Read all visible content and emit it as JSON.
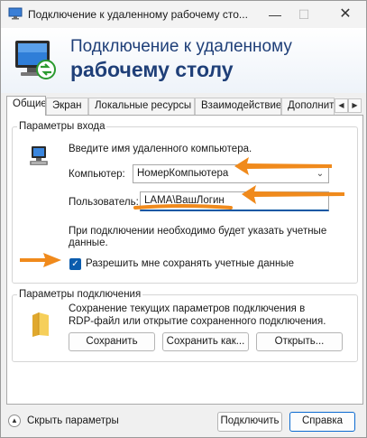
{
  "window": {
    "title": "Подключение к удаленному рабочему сто...",
    "minimize": "—",
    "maximize": "☐",
    "close": "✕"
  },
  "banner": {
    "line1": "Подключение к удаленному",
    "line2": "рабочему столу"
  },
  "tabs": [
    "Общие",
    "Экран",
    "Локальные ресурсы",
    "Взаимодействие",
    "Дополнит"
  ],
  "tab_scroll": {
    "left": "◀",
    "right": "▶"
  },
  "login": {
    "legend": "Параметры входа",
    "prompt": "Введите имя удаленного компьютера.",
    "computer_label": "Компьютер:",
    "computer_value": "НомерКомпьютера",
    "user_label": "Пользователь:",
    "user_value": "LAMA\\ВашЛогин",
    "note_line1": "При подключении необходимо будет указать учетные",
    "note_line2": "данные.",
    "save_creds_label": "Разрешить мне сохранять учетные данные",
    "save_creds_checked": true
  },
  "connection": {
    "legend": "Параметры подключения",
    "desc_line1": "Сохранение текущих параметров подключения в",
    "desc_line2": "RDP-файл или открытие сохраненного подключения.",
    "save": "Сохранить",
    "save_as": "Сохранить как...",
    "open": "Открыть..."
  },
  "bottom": {
    "hide_options": "Скрыть параметры",
    "connect": "Подключить",
    "help": "Справка"
  },
  "colors": {
    "accent": "#0b5cad",
    "annotation_arrow": "#f08a1c",
    "banner_text": "#1f3f78"
  }
}
